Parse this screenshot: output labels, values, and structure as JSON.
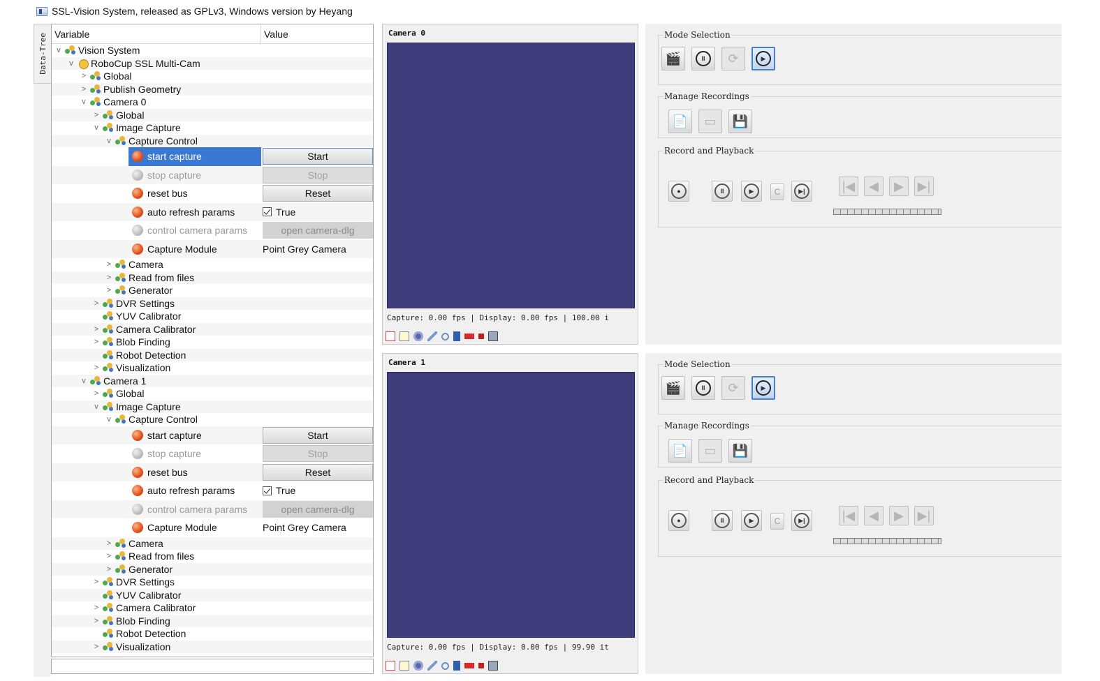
{
  "window": {
    "title": "SSL-Vision System, released as GPLv3, Windows version by Heyang"
  },
  "side_tab": {
    "label": "Data-Tree"
  },
  "tree": {
    "headers": {
      "variable": "Variable",
      "value": "Value"
    },
    "rows": [
      {
        "indent": 0,
        "exp": "v",
        "icon": "tree",
        "label": "Vision System"
      },
      {
        "indent": 1,
        "exp": "v",
        "icon": "robo",
        "label": "RoboCup SSL Multi-Cam"
      },
      {
        "indent": 2,
        "exp": ">",
        "icon": "tree",
        "label": "Global"
      },
      {
        "indent": 2,
        "exp": ">",
        "icon": "tree",
        "label": "Publish Geometry"
      },
      {
        "indent": 2,
        "exp": "v",
        "icon": "tree",
        "label": "Camera 0"
      },
      {
        "indent": 3,
        "exp": ">",
        "icon": "tree",
        "label": "Global"
      },
      {
        "indent": 3,
        "exp": "v",
        "icon": "tree",
        "label": "Image Capture"
      },
      {
        "indent": 4,
        "exp": "v",
        "icon": "tree",
        "label": "Capture Control"
      },
      {
        "type": "big",
        "ball": "red",
        "label": "start capture",
        "btn": "Start",
        "selected": true
      },
      {
        "type": "big",
        "ball": "grey",
        "label": "stop capture",
        "btn": "Stop",
        "disabled": true
      },
      {
        "type": "big",
        "ball": "red",
        "label": "reset bus",
        "btn": "Reset"
      },
      {
        "type": "check",
        "ball": "red",
        "label": "auto refresh params",
        "value": "True"
      },
      {
        "type": "field",
        "ball": "grey",
        "label": "control camera params",
        "value": "open camera-dlg",
        "disabled": true
      },
      {
        "type": "text",
        "ball": "red",
        "label": "Capture Module",
        "value": "Point Grey Camera"
      },
      {
        "indent": 4,
        "exp": ">",
        "icon": "tree",
        "label": "Camera"
      },
      {
        "indent": 4,
        "exp": ">",
        "icon": "tree",
        "label": "Read from files"
      },
      {
        "indent": 4,
        "exp": ">",
        "icon": "tree",
        "label": "Generator"
      },
      {
        "indent": 3,
        "exp": ">",
        "icon": "tree",
        "label": "DVR Settings"
      },
      {
        "indent": 3,
        "exp": "",
        "icon": "tree",
        "label": "YUV Calibrator"
      },
      {
        "indent": 3,
        "exp": ">",
        "icon": "tree",
        "label": "Camera Calibrator"
      },
      {
        "indent": 3,
        "exp": ">",
        "icon": "tree",
        "label": "Blob Finding"
      },
      {
        "indent": 3,
        "exp": "",
        "icon": "tree",
        "label": "Robot Detection"
      },
      {
        "indent": 3,
        "exp": ">",
        "icon": "tree",
        "label": "Visualization"
      },
      {
        "indent": 2,
        "exp": "v",
        "icon": "tree",
        "label": "Camera 1"
      },
      {
        "indent": 3,
        "exp": ">",
        "icon": "tree",
        "label": "Global"
      },
      {
        "indent": 3,
        "exp": "v",
        "icon": "tree",
        "label": "Image Capture"
      },
      {
        "indent": 4,
        "exp": "v",
        "icon": "tree",
        "label": "Capture Control"
      },
      {
        "type": "big",
        "ball": "red",
        "label": "start capture",
        "btn": "Start"
      },
      {
        "type": "big",
        "ball": "grey",
        "label": "stop capture",
        "btn": "Stop",
        "disabled": true
      },
      {
        "type": "big",
        "ball": "red",
        "label": "reset bus",
        "btn": "Reset"
      },
      {
        "type": "check",
        "ball": "red",
        "label": "auto refresh params",
        "value": "True"
      },
      {
        "type": "field",
        "ball": "grey",
        "label": "control camera params",
        "value": "open camera-dlg",
        "disabled": true
      },
      {
        "type": "text",
        "ball": "red",
        "label": "Capture Module",
        "value": "Point Grey Camera"
      },
      {
        "indent": 4,
        "exp": ">",
        "icon": "tree",
        "label": "Camera"
      },
      {
        "indent": 4,
        "exp": ">",
        "icon": "tree",
        "label": "Read from files"
      },
      {
        "indent": 4,
        "exp": ">",
        "icon": "tree",
        "label": "Generator"
      },
      {
        "indent": 3,
        "exp": ">",
        "icon": "tree",
        "label": "DVR Settings"
      },
      {
        "indent": 3,
        "exp": "",
        "icon": "tree",
        "label": "YUV Calibrator"
      },
      {
        "indent": 3,
        "exp": ">",
        "icon": "tree",
        "label": "Camera Calibrator"
      },
      {
        "indent": 3,
        "exp": ">",
        "icon": "tree",
        "label": "Blob Finding"
      },
      {
        "indent": 3,
        "exp": "",
        "icon": "tree",
        "label": "Robot Detection"
      },
      {
        "indent": 3,
        "exp": ">",
        "icon": "tree",
        "label": "Visualization"
      }
    ]
  },
  "cameras": [
    {
      "title": "Camera 0",
      "status": "Capture: 0.00 fps | Display: 0.00 fps | 100.00 i",
      "view_color": "#3f3c7c"
    },
    {
      "title": "Camera 1",
      "status": "Capture: 0.00 fps | Display: 0.00 fps | 99.90 it",
      "view_color": "#3f3c7c"
    }
  ],
  "controls": {
    "mode_selection": "Mode Selection",
    "manage_recordings": "Manage Recordings",
    "record_playback": "Record and Playback",
    "pause_glyph": "II",
    "step_glyph": "C",
    "mode_icons": [
      "film-clapper-icon",
      "pause-icon",
      "refresh-icon",
      "play-icon"
    ],
    "manage_icons": [
      "new-recording-icon",
      "monitor-icon",
      "save-icon"
    ],
    "playback_icons": [
      "record-icon",
      "pause-icon",
      "play-icon",
      "step-icon",
      "skip-icon"
    ],
    "nav_icons": [
      "first-frame-icon",
      "prev-frame-icon",
      "next-frame-icon",
      "last-frame-icon"
    ]
  },
  "colors": {
    "selection": "#3b78d4",
    "camera_view": "#3f3c7c",
    "active_button_border": "#4a7fc9"
  }
}
